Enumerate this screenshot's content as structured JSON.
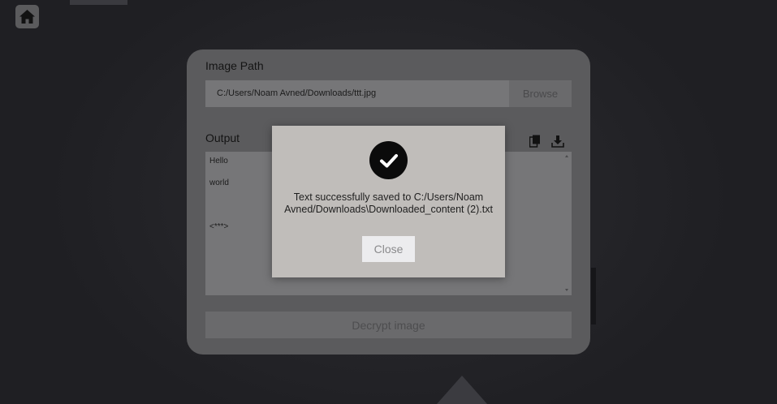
{
  "nav": {
    "home_icon": "home-icon"
  },
  "panel": {
    "image_path_label": "Image Path",
    "image_path_value": "C:/Users/Noam Avned/Downloads/ttt.jpg",
    "browse_label": "Browse",
    "output_label": "Output",
    "copy_icon": "copy-icon",
    "download_icon": "download-icon",
    "output_lines": [
      "Hello",
      "world",
      "",
      "<***>"
    ],
    "decrypt_label": "Decrypt image"
  },
  "modal": {
    "icon": "check-circle-icon",
    "message": "Text successfully saved to C:/Users/Noam Avned/Downloads\\Downloaded_content (2).txt",
    "close_label": "Close"
  }
}
